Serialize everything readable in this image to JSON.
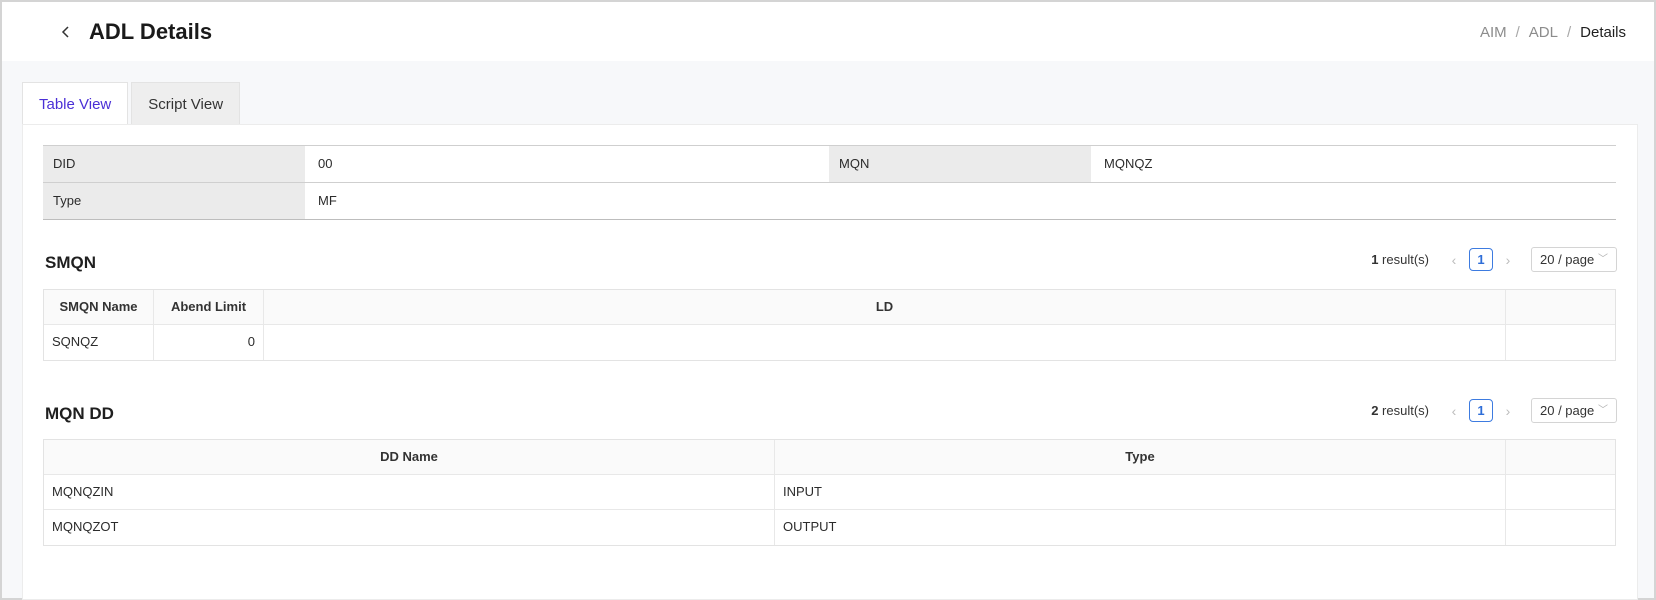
{
  "header": {
    "title": "ADL Details",
    "breadcrumb": [
      "AIM",
      "ADL",
      "Details"
    ]
  },
  "tabs": [
    {
      "label": "Table View",
      "active": true
    },
    {
      "label": "Script View",
      "active": false
    }
  ],
  "info": {
    "did_label": "DID",
    "did_value": "00",
    "mqn_label": "MQN",
    "mqn_value": "MQNQZ",
    "type_label": "Type",
    "type_value": "MF"
  },
  "smqn": {
    "title": "SMQN",
    "result_count": "1",
    "result_suffix": " result(s)",
    "page": "1",
    "page_size": "20 / page",
    "columns": [
      "SMQN Name",
      "Abend Limit",
      "LD"
    ],
    "rows": [
      [
        "SQNQZ",
        "0",
        ""
      ]
    ]
  },
  "mqn_dd": {
    "title": "MQN DD",
    "result_count": "2",
    "result_suffix": " result(s)",
    "page": "1",
    "page_size": "20 / page",
    "columns": [
      "DD Name",
      "Type"
    ],
    "rows": [
      [
        "MQNQZIN",
        "INPUT"
      ],
      [
        "MQNQZOT",
        "OUTPUT"
      ]
    ]
  },
  "colors": {
    "active_tab": "#4a2fd6",
    "pager_accent": "#2f6ed8"
  }
}
